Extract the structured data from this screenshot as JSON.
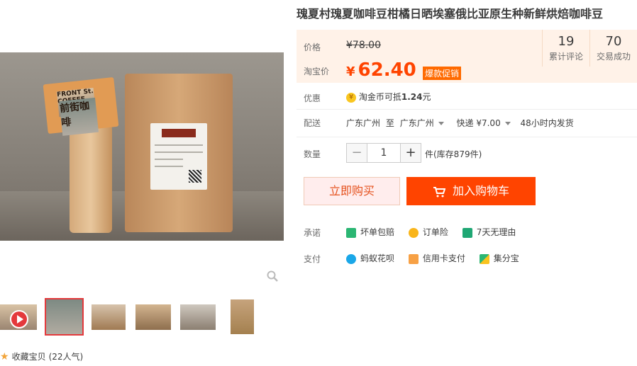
{
  "product": {
    "title": "瑰夏村瑰夏咖啡豆柑橘日晒埃塞俄比亚原生种新鲜烘焙咖啡豆",
    "main_image_sign_line1": "FRONT St. COFFEE",
    "main_image_sign_line2": "前街咖啡"
  },
  "price": {
    "label": "价格",
    "original": "¥78.00",
    "tb_label": "淘宝价",
    "currency": "¥",
    "current": "62.40",
    "promo": "爆款促销"
  },
  "stats": [
    {
      "number": "19",
      "label": "累计评论"
    },
    {
      "number": "70",
      "label": "交易成功"
    }
  ],
  "youhui": {
    "label": "优惠",
    "coin_icon": "¥",
    "text": "淘金币可抵",
    "amount": "1.24",
    "unit": "元"
  },
  "shipping": {
    "label": "配送",
    "from": "广东广州",
    "to_word": "至",
    "to": "广东广州",
    "method": "快递 ¥7.00",
    "ship_time": "48小时内发货"
  },
  "quantity": {
    "label": "数量",
    "minus": "−",
    "value": "1",
    "plus": "+",
    "stock": "件(库存879件)"
  },
  "actions": {
    "buy_now": "立即购买",
    "add_cart": "加入购物车"
  },
  "promise": {
    "label": "承诺",
    "items": [
      "坏单包赔",
      "订单险",
      "7天无理由"
    ]
  },
  "payment": {
    "label": "支付",
    "items": [
      "蚂蚁花呗",
      "信用卡支付",
      "集分宝"
    ]
  },
  "collect": {
    "text": "收藏宝贝",
    "count": "(22人气)"
  },
  "colors": {
    "accent": "#ff4400",
    "promo": "#ff6a00",
    "price_bg": "#fff2e8"
  }
}
